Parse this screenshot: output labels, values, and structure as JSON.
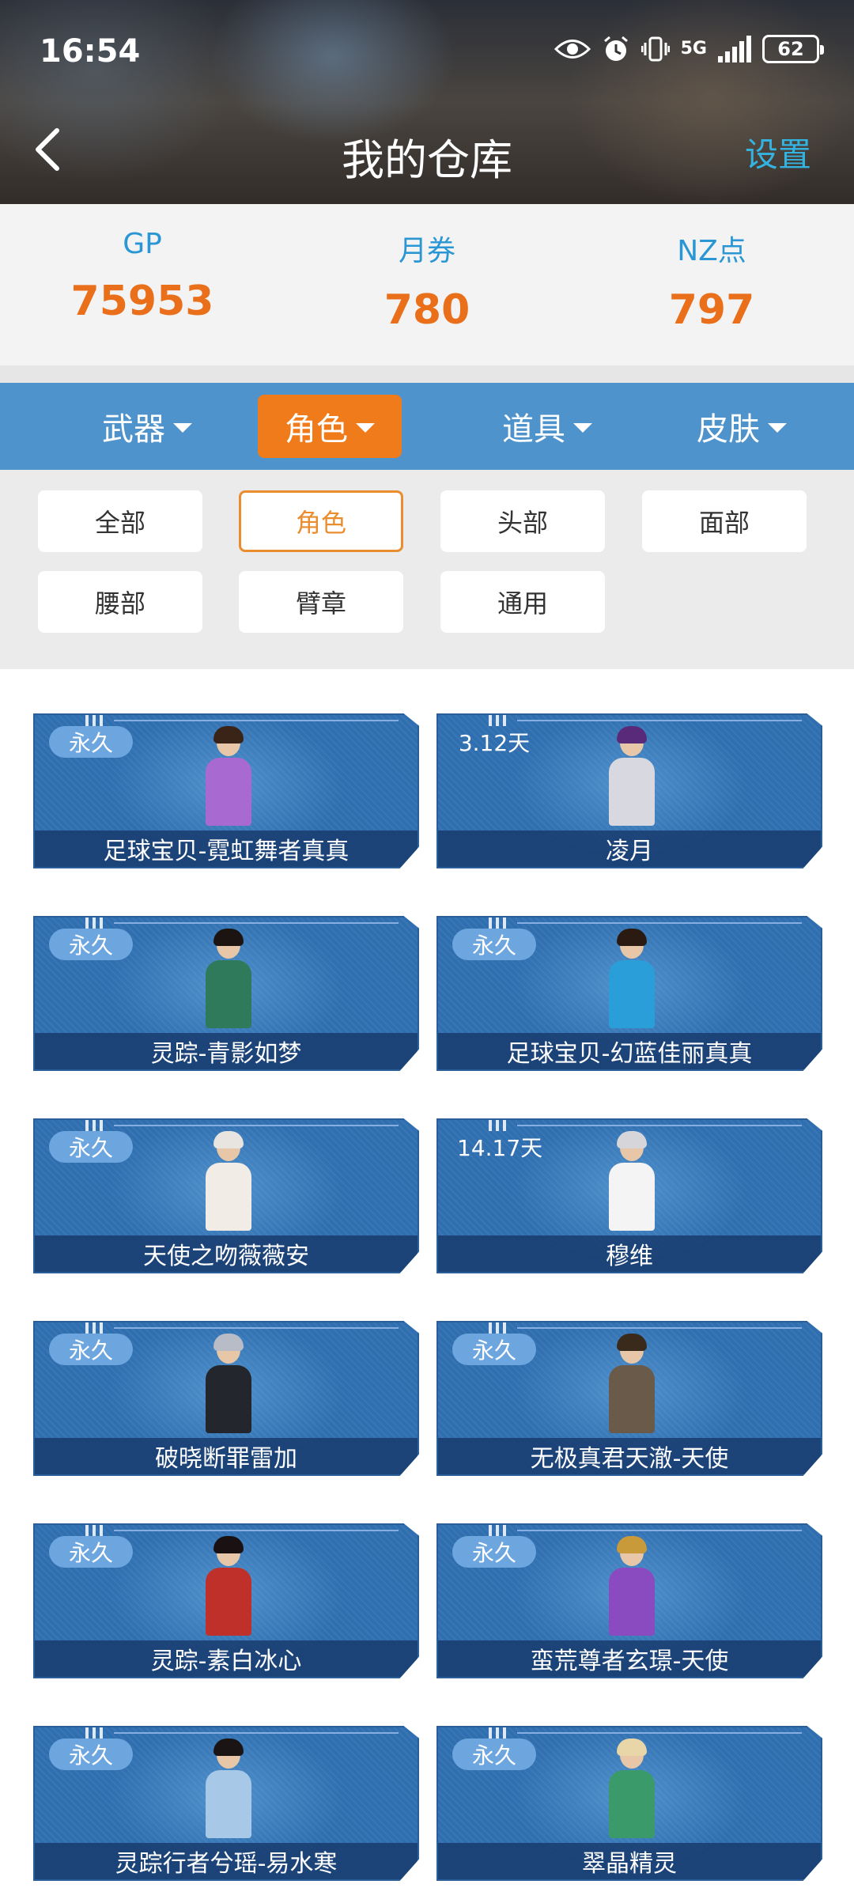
{
  "status_bar": {
    "time": "16:54",
    "network": "5G",
    "battery": "62"
  },
  "header": {
    "title": "我的仓库",
    "settings_label": "设置"
  },
  "currency": [
    {
      "label": "GP",
      "value": "75953"
    },
    {
      "label": "月券",
      "value": "780"
    },
    {
      "label": "NZ点",
      "value": "797"
    }
  ],
  "category_tabs": [
    {
      "label": "武器",
      "active": false
    },
    {
      "label": "角色",
      "active": true
    },
    {
      "label": "道具",
      "active": false
    },
    {
      "label": "皮肤",
      "active": false
    }
  ],
  "filters": [
    {
      "label": "全部",
      "active": false
    },
    {
      "label": "角色",
      "active": true
    },
    {
      "label": "头部",
      "active": false
    },
    {
      "label": "面部",
      "active": false
    },
    {
      "label": "腰部",
      "active": false
    },
    {
      "label": "臂章",
      "active": false
    },
    {
      "label": "通用",
      "active": false
    }
  ],
  "items": [
    {
      "badge": "永久",
      "name": "足球宝贝-霓虹舞者真真"
    },
    {
      "badge": "3.12天",
      "name": "凌月"
    },
    {
      "badge": "永久",
      "name": "灵踪-青影如梦"
    },
    {
      "badge": "永久",
      "name": "足球宝贝-幻蓝佳丽真真"
    },
    {
      "badge": "永久",
      "name": "天使之吻薇薇安"
    },
    {
      "badge": "14.17天",
      "name": "穆维"
    },
    {
      "badge": "永久",
      "name": "破晓断罪雷加"
    },
    {
      "badge": "永久",
      "name": "无极真君天澈-天使"
    },
    {
      "badge": "永久",
      "name": "灵踪-素白冰心"
    },
    {
      "badge": "永久",
      "name": "蛮荒尊者玄璟-天使"
    },
    {
      "badge": "永久",
      "name": "灵踪行者兮瑶-易水寒"
    },
    {
      "badge": "永久",
      "name": "翠晶精灵"
    }
  ],
  "colors": {
    "accent_orange": "#e96f1b",
    "label_blue": "#2a96d4",
    "tab_bar_blue": "#4f93cc",
    "settings_cyan": "#35b3e0"
  }
}
